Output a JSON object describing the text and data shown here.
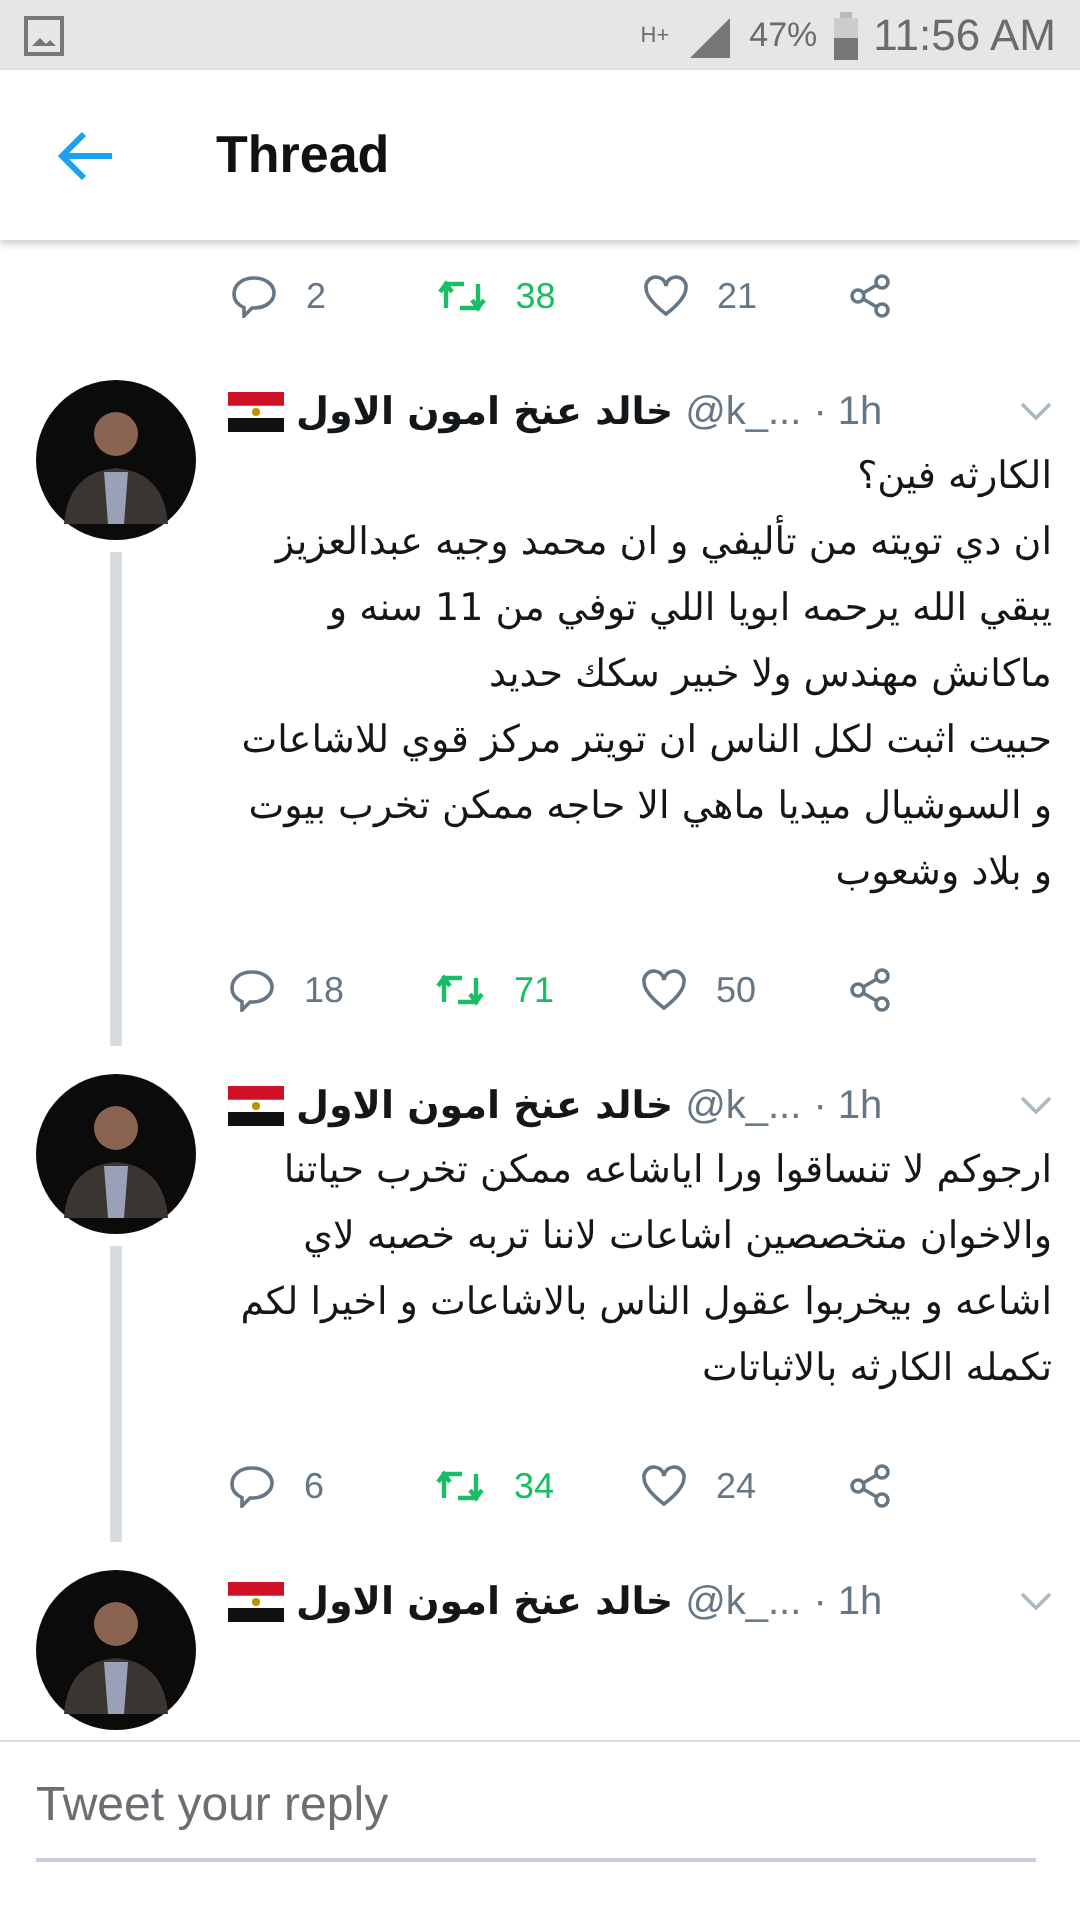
{
  "status_bar": {
    "network": "H+",
    "battery": "47%",
    "time": "11:56 AM"
  },
  "header": {
    "title": "Thread"
  },
  "previous_actions": {
    "replies": "2",
    "retweets": "38",
    "likes": "21",
    "retweeted": true
  },
  "tweets": [
    {
      "name": "خالد عنخ امون الاول",
      "handle": "@k_...",
      "time": "· 1h",
      "text": "الكارثه فين؟\nان دي تويته من تأليفي و ان محمد وجيه عبدالعزيز يبقي الله يرحمه ابويا اللي توفي من 11 سنه و ماكانش مهندس ولا خبير سكك حديد\nحبيت اثبت لكل الناس ان تويتر مركز قوي للاشاعات و السوشيال ميديا ماهي الا حاجه ممكن تخرب بيوت و بلاد وشعوب",
      "replies": "18",
      "retweets": "71",
      "likes": "50",
      "retweeted": true
    },
    {
      "name": "خالد عنخ امون الاول",
      "handle": "@k_...",
      "time": "· 1h",
      "text": "ارجوكم لا تنساقوا ورا اياشاعه ممكن تخرب حياتنا والاخوان متخصصين اشاعات لاننا تربه خصبه لاي اشاعه و بيخربوا عقول الناس بالاشاعات و اخيرا لكم تكمله الكارثه بالاثباتات",
      "replies": "6",
      "retweets": "34",
      "likes": "24",
      "retweeted": true
    },
    {
      "name": "خالد عنخ امون الاول",
      "handle": "@k_...",
      "time": "· 1h"
    }
  ],
  "reply": {
    "placeholder": "Tweet your reply"
  }
}
